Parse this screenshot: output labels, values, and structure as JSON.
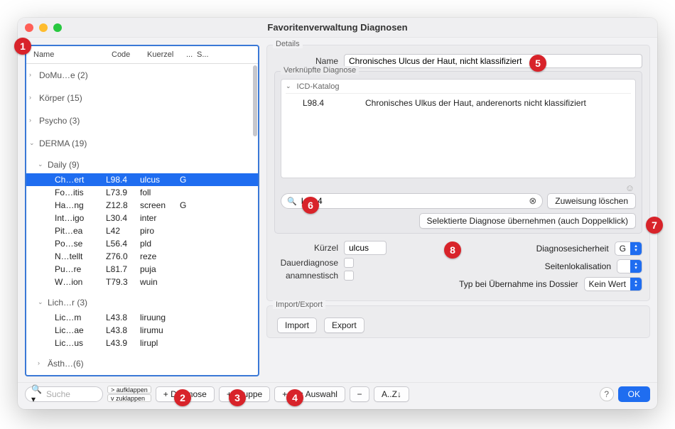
{
  "window_title": "Favoritenverwaltung Diagnosen",
  "tree": {
    "headers": {
      "name": "Name",
      "code": "Code",
      "kuerzel": "Kuerzel",
      "dots": "...",
      "s": "S..."
    },
    "groups": [
      {
        "label": "DoMu…e (2)"
      },
      {
        "label": "Körper (15)"
      },
      {
        "label": "Psycho (3)"
      },
      {
        "label": "DERMA (19)",
        "open": true,
        "children": [
          {
            "label": "Daily (9)",
            "open": true,
            "rows": [
              {
                "name": "Ch…ert",
                "code": "L98.4",
                "kue": "ulcus",
                "s": "G",
                "selected": true
              },
              {
                "name": "Fo…itis",
                "code": "L73.9",
                "kue": "foll",
                "s": ""
              },
              {
                "name": "Ha…ng",
                "code": "Z12.8",
                "kue": "screen",
                "s": "G"
              },
              {
                "name": "Int…igo",
                "code": "L30.4",
                "kue": "inter",
                "s": ""
              },
              {
                "name": "Pit…ea",
                "code": "L42",
                "kue": "piro",
                "s": ""
              },
              {
                "name": "Po…se",
                "code": "L56.4",
                "kue": "pld",
                "s": ""
              },
              {
                "name": "N…tellt",
                "code": "Z76.0",
                "kue": "reze",
                "s": ""
              },
              {
                "name": "Pu…re",
                "code": "L81.7",
                "kue": "puja",
                "s": ""
              },
              {
                "name": "W…ion",
                "code": "T79.3",
                "kue": "wuin",
                "s": ""
              }
            ]
          },
          {
            "label": "Lich…r (3)",
            "open": true,
            "rows": [
              {
                "name": "Lic…m",
                "code": "L43.8",
                "kue": "liruung",
                "s": ""
              },
              {
                "name": "Lic…ae",
                "code": "L43.8",
                "kue": "lirumu",
                "s": ""
              },
              {
                "name": "Lic…us",
                "code": "L43.9",
                "kue": "lirupl",
                "s": ""
              }
            ]
          },
          {
            "label": "Ästh…(6)"
          }
        ]
      }
    ]
  },
  "details": {
    "title": "Details",
    "name_label": "Name",
    "name_value": "Chronisches Ulcus der Haut, nicht klassifiziert",
    "linked_title": "Verknüpfte Diagnose",
    "icd_header": "ICD-Katalog",
    "icd_code": "L98.4",
    "icd_text": "Chronisches Ulkus der Haut, anderenorts nicht klassifiziert",
    "search_value": "L98.4",
    "btn_clear_assign": "Zuweisung löschen",
    "btn_take_over": "Selektierte Diagnose übernehmen (auch Doppelklick)",
    "kuerzel_label": "Kürzel",
    "kuerzel_value": "ulcus",
    "dauer_label": "Dauerdiagnose",
    "anam_label": "anamnestisch",
    "sicherheit_label": "Diagnosesicherheit",
    "sicherheit_value": "G",
    "lokal_label": "Seitenlokalisation",
    "lokal_value": "",
    "typ_label": "Typ bei Übernahme ins Dossier",
    "typ_value": "Kein Wert"
  },
  "impexp": {
    "title": "Import/Export",
    "import": "Import",
    "export": "Export"
  },
  "bottom": {
    "search_placeholder": "Suche",
    "expand": "> aufklappen",
    "collapse": "v zuklappen",
    "add_diag": "+ Diagnose",
    "add_group": "+ Gruppe",
    "from_sel": "+ aus Auswahl",
    "remove": "−",
    "sort": "A..Z↓",
    "ok": "OK",
    "help": "?"
  },
  "badges": {
    "b1": "1",
    "b2": "2",
    "b3": "3",
    "b4": "4",
    "b5": "5",
    "b6": "6",
    "b7": "7",
    "b8": "8"
  }
}
